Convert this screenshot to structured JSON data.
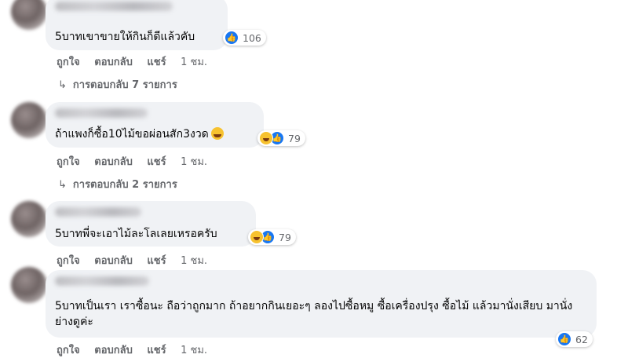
{
  "comments": [
    {
      "text": "5บาทเขาขายให้กินก็ดีแล้วคับ",
      "reaction_count": "106",
      "actions": {
        "like": "ถูกใจ",
        "reply": "ตอบกลับ",
        "share": "แชร์",
        "time": "1 ชม."
      },
      "replies_label": "การตอบกลับ 7 รายการ"
    },
    {
      "text": "ถ้าแพงก็ซื้อ10ไม้ขอผ่อนสัก3งวด",
      "reaction_count": "79",
      "actions": {
        "like": "ถูกใจ",
        "reply": "ตอบกลับ",
        "share": "แชร์",
        "time": "1 ชม."
      },
      "replies_label": "การตอบกลับ 2 รายการ"
    },
    {
      "text": "5บาทพี่จะเอาไม้ละโลเลยเหรอครับ",
      "reaction_count": "79",
      "actions": {
        "like": "ถูกใจ",
        "reply": "ตอบกลับ",
        "share": "แชร์",
        "time": "1 ชม."
      }
    },
    {
      "text": "5บาทเป็นเรา เราซื้อนะ ถือว่าถูกมาก ถ้าอยากกินเยอะๆ ลองไปซื้อหมู ซื้อเครื่องปรุง ซื้อไม้ แล้วมานั่งเสียบ มานั่งย่างดูค่ะ",
      "reaction_count": "62",
      "actions": {
        "like": "ถูกใจ",
        "reply": "ตอบกลับ",
        "share": "แชร์",
        "time": "1 ชม."
      }
    }
  ],
  "icons": {
    "like": "thumbs-up-icon",
    "haha": "laughing-face-icon",
    "reply_arrow": "reply-arrow-icon"
  },
  "colors": {
    "like_blue": "#1877f2",
    "bubble_bg": "#f0f2f5",
    "meta_gray": "#65676b"
  }
}
